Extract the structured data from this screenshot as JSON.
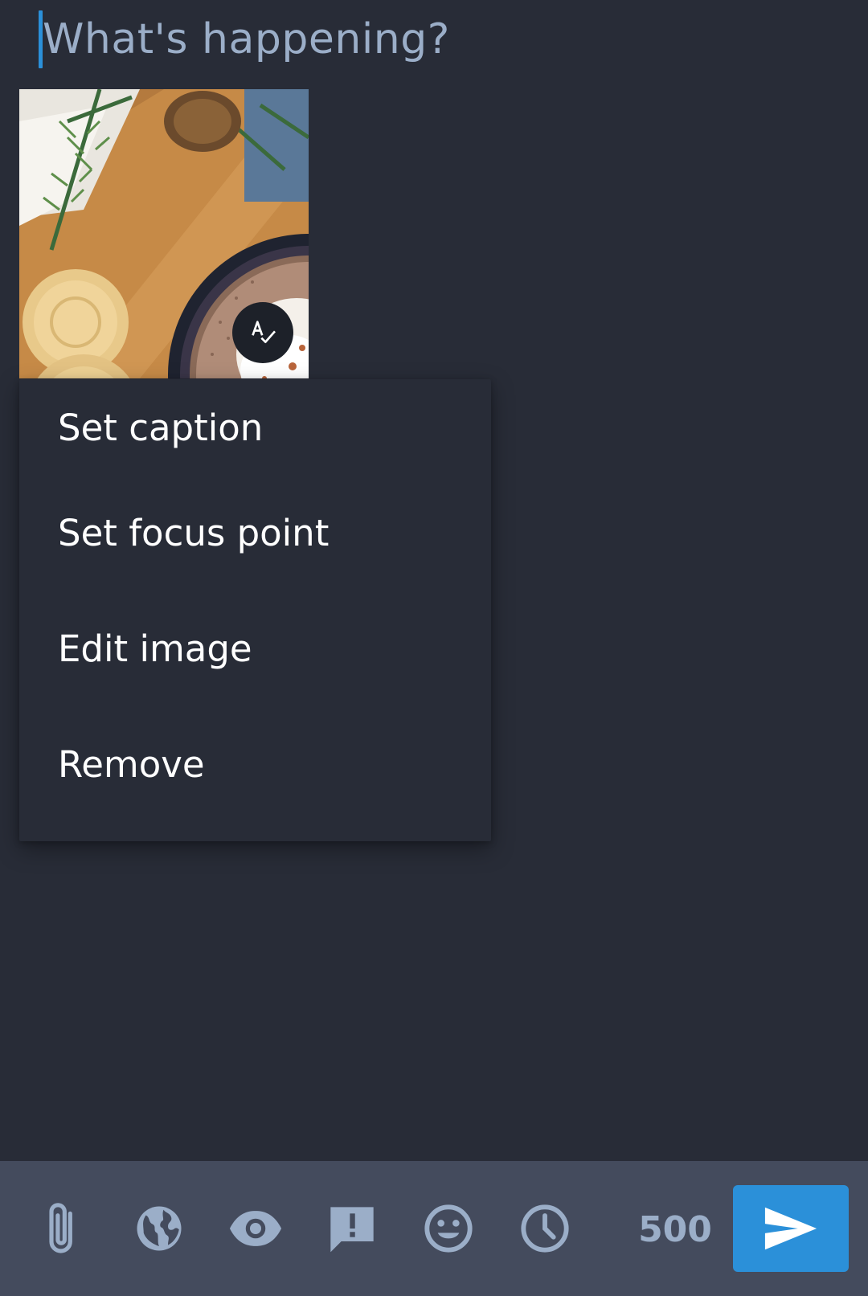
{
  "compose": {
    "placeholder": "What's happening?"
  },
  "attachment": {
    "alt_badge_icon": "spellcheck-icon"
  },
  "menu": {
    "items": [
      {
        "label": "Set caption"
      },
      {
        "label": "Set focus point"
      },
      {
        "label": "Edit image"
      },
      {
        "label": "Remove"
      }
    ]
  },
  "toolbar": {
    "icons": [
      "paperclip-icon",
      "globe-icon",
      "eye-icon",
      "alert-bubble-icon",
      "emoji-icon",
      "clock-icon"
    ],
    "char_count": "500",
    "send_icon": "send-icon"
  },
  "colors": {
    "background": "#282c37",
    "toolbar": "#444b5d",
    "accent": "#2b90d9",
    "muted": "#9baec8"
  }
}
